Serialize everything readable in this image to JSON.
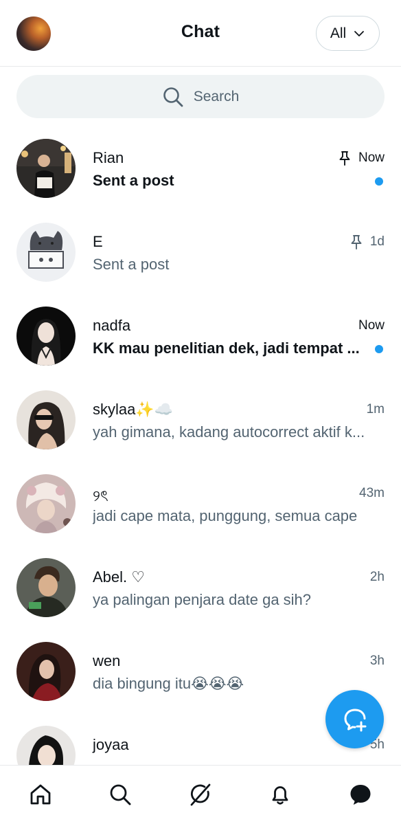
{
  "header": {
    "title": "Chat",
    "filter_label": "All"
  },
  "search": {
    "placeholder": "Search"
  },
  "conversations": [
    {
      "name": "Rian",
      "message": "Sent a post",
      "time": "Now",
      "pinned": true,
      "unread": true
    },
    {
      "name": "E",
      "message": "Sent a post",
      "time": "1d",
      "pinned": true,
      "unread": false
    },
    {
      "name": "nadfa",
      "message": "KK mau penelitian dek, jadi tempat ...",
      "time": "Now",
      "pinned": false,
      "unread": true
    },
    {
      "name": "skylaa✨☁️",
      "message": "yah gimana, kadang autocorrect aktif k...",
      "time": "1m",
      "pinned": false,
      "unread": false
    },
    {
      "name": "୨ৎ",
      "message": "jadi cape mata, punggung, semua cape",
      "time": "43m",
      "pinned": false,
      "unread": false
    },
    {
      "name": "Abel. ♡",
      "message": "ya palingan penjara date ga sih?",
      "time": "2h",
      "pinned": false,
      "unread": false
    },
    {
      "name": "wen",
      "message": "dia bingung itu😭😭😭",
      "time": "3h",
      "pinned": false,
      "unread": false
    },
    {
      "name": "joyaa",
      "message": "",
      "time": "5h",
      "pinned": false,
      "unread": false
    }
  ],
  "bottom_nav": [
    "home-icon",
    "search-icon",
    "grok-icon",
    "notifications-icon",
    "messages-icon"
  ],
  "colors": {
    "accent": "#1d9bf0",
    "text": "#0f1419",
    "secondary_text": "#536471",
    "search_bg": "#eff3f4",
    "divider": "#e7e9ea"
  }
}
